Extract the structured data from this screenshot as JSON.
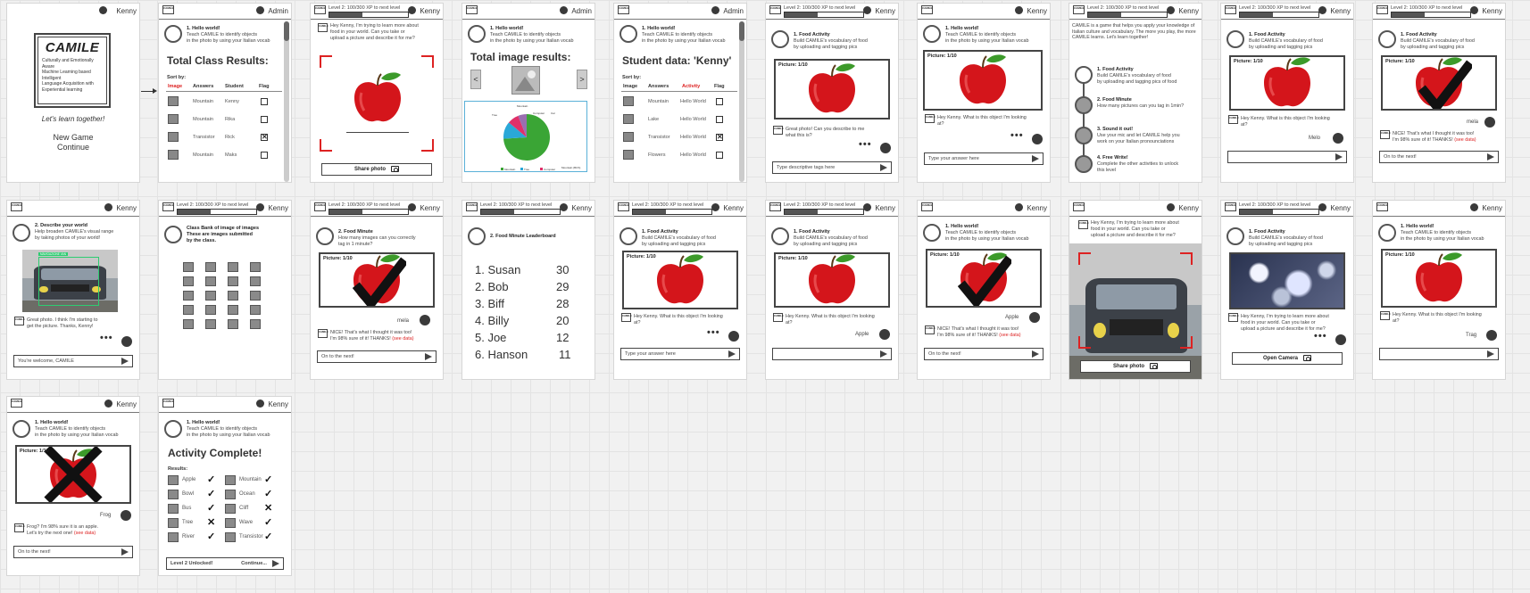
{
  "users": {
    "kenny": "Kenny",
    "admin": "Admin"
  },
  "logo_mini": "CAMILE",
  "xp": {
    "label": "Level 2: 100/300 XP to next level",
    "progress": 0.33
  },
  "home": {
    "title": "CAMILE",
    "lines": [
      "Culturally and Emotionally",
      "Aware",
      "Machine Learning based",
      "Intelligent",
      "Language Acquisition with",
      "Experiential learning"
    ],
    "tagline": "Let's learn together!",
    "new_game": "New Game",
    "continue": "Continue"
  },
  "act": {
    "hello": {
      "title": "1. Hello world!",
      "desc1": "Teach CAMILE to identify objects",
      "desc2": "in the photo by using your Italian vocab"
    },
    "food": {
      "title": "1. Food Activity",
      "desc1": "Build CAMILE's vocabulary of food",
      "desc2": "by uploading and tagging pics"
    },
    "describe": {
      "title": "2. Describe your world",
      "desc1": "Help broaden CAMILE's visual range",
      "desc2": "by taking photos of your world!"
    },
    "minute": {
      "title": "2. Food Minute",
      "desc1": "How many images can you correctly",
      "desc2": "tag in 1 minute?"
    },
    "leader": {
      "title": "2. Food Minute Leaderboard"
    },
    "bank": {
      "title": "Class Bank of image of images",
      "desc1": "These are images submitted",
      "desc2": "by the class."
    }
  },
  "class_results": {
    "title": "Total Class Results:",
    "sort": "Sort by:",
    "headers": [
      "Image",
      "Answers",
      "Student",
      "Flag"
    ],
    "rows": [
      {
        "answer": "Mountain",
        "student": "Kenny",
        "flag": ""
      },
      {
        "answer": "Mountain",
        "student": "Rika",
        "flag": ""
      },
      {
        "answer": "Transistor",
        "student": "Rick",
        "flag": "✕"
      },
      {
        "answer": "Mountain",
        "student": "Maks",
        "flag": ""
      }
    ]
  },
  "image_results": {
    "title": "Total image results:",
    "labels": [
      "Mountain",
      "Tree",
      "Car",
      "Computer",
      "Mountain (BUS)"
    ],
    "legend": [
      "Mountain",
      "Tree",
      "Computer"
    ],
    "colors": [
      "#3aa535",
      "#2aa8d8",
      "#e0306a",
      "#9a6fb0"
    ]
  },
  "student_data": {
    "title": "Student data: 'Kenny'",
    "sort": "Sort by:",
    "headers": [
      "Image",
      "Answers",
      "Activity",
      "Flag"
    ],
    "rows": [
      {
        "answer": "Mountain",
        "activity": "Hello World",
        "flag": ""
      },
      {
        "answer": "Lake",
        "activity": "Hello World",
        "flag": ""
      },
      {
        "answer": "Transistor",
        "activity": "Hello World",
        "flag": "✕"
      },
      {
        "answer": "Flowers",
        "activity": "Hello World",
        "flag": ""
      }
    ]
  },
  "msgs": {
    "learn": "Hey Kenny, I'm trying to learn more about",
    "learn2": "food in your world. Can you take or",
    "learn3": "upload a picture and describe it for me?",
    "great": "Great photo! Can you describe to me",
    "great2": "what this is?",
    "what": "Hey Kenny. What is this object I'm looking",
    "what2": "at?",
    "nice": "NICE! That's what I thought it was too!",
    "nice2": "I'm 98% sure of it! THANKS!",
    "see": "(see data)",
    "welcome": "Great photo. I think I'm starting to",
    "welcome2": "get the picture. Thanks, Kenny!",
    "frog": "Frog? I'm 98% sure it is an apple.",
    "frog2": "Let's try the next one!"
  },
  "inputs": {
    "tags": "Type descriptive tags here",
    "answer": "Type your answer here",
    "next": "On to the next!",
    "welcome": "You're welcome, CAMILE",
    "level2": "Level 2 Unlocked!",
    "cont": "Continue..."
  },
  "buttons": {
    "share": "Share photo",
    "camera": "Open Camera"
  },
  "picture_label": "Picture: 1/10",
  "answers": {
    "mela": "mela",
    "melo": "Melo",
    "apple": "Apple",
    "trag": "Trag",
    "frog": "Frog"
  },
  "menu_intro": "CAMILE is a game that helps you apply your knowledge of Italian culture and vocabulary. The more you play, the more CAMILE learns. Let's learn together!",
  "menu_items": [
    {
      "title": "1. Food Activity",
      "d1": "Build CAMILE's vocabulary of food",
      "d2": "by uploading and tagging pics of food"
    },
    {
      "title": "2. Food Minute",
      "d1": "How many pictures can you tag in 1min?",
      "d2": ""
    },
    {
      "title": "3. Sound it out!",
      "d1": "Use your mic and let CAMILE help you",
      "d2": "work on your Italian pronounciations"
    },
    {
      "title": "4. Free Write!",
      "d1": "Complete the other activities to unlock",
      "d2": "this level"
    }
  ],
  "leaderboard": [
    {
      "name": "1. Susan",
      "score": "30"
    },
    {
      "name": "2. Bob",
      "score": "29"
    },
    {
      "name": "3. Biff",
      "score": "28"
    },
    {
      "name": "4. Billy",
      "score": "20"
    },
    {
      "name": "5. Joe",
      "score": "12"
    },
    {
      "name": "6. Hanson",
      "score": "11"
    }
  ],
  "complete": {
    "title": "Activity Complete!",
    "results": "Results:",
    "items": [
      {
        "name": "Apple",
        "ok": "✓"
      },
      {
        "name": "Mountain",
        "ok": "✓"
      },
      {
        "name": "Bowl",
        "ok": "✓"
      },
      {
        "name": "Ocean",
        "ok": "✓"
      },
      {
        "name": "Bus",
        "ok": "✓"
      },
      {
        "name": "Cliff",
        "ok": "✕"
      },
      {
        "name": "Tree",
        "ok": "✕"
      },
      {
        "name": "Wave",
        "ok": "✓"
      },
      {
        "name": "River",
        "ok": "✓"
      },
      {
        "name": "Transistor",
        "ok": "✓"
      }
    ]
  },
  "van_tag": "MAVIGAZIONE VAN"
}
